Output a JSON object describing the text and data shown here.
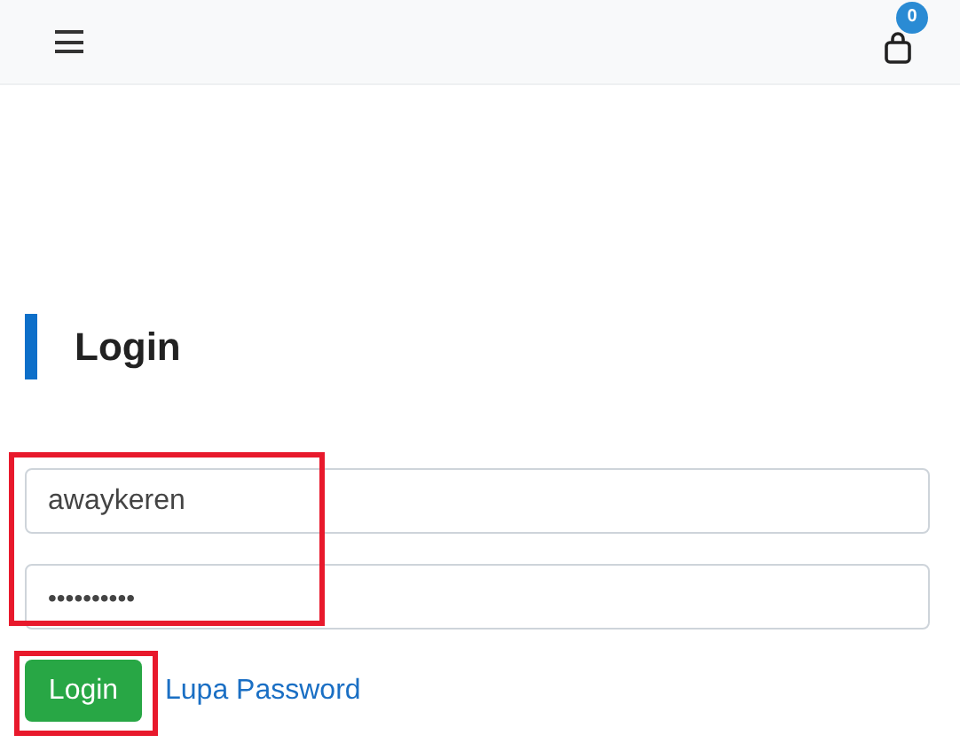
{
  "header": {
    "cart_count": "0"
  },
  "title": "Login",
  "form": {
    "username": {
      "value": "awaykeren"
    },
    "password": {
      "value": "••••••••••"
    },
    "submit": "Login",
    "forgot_link": "Lupa Password"
  }
}
